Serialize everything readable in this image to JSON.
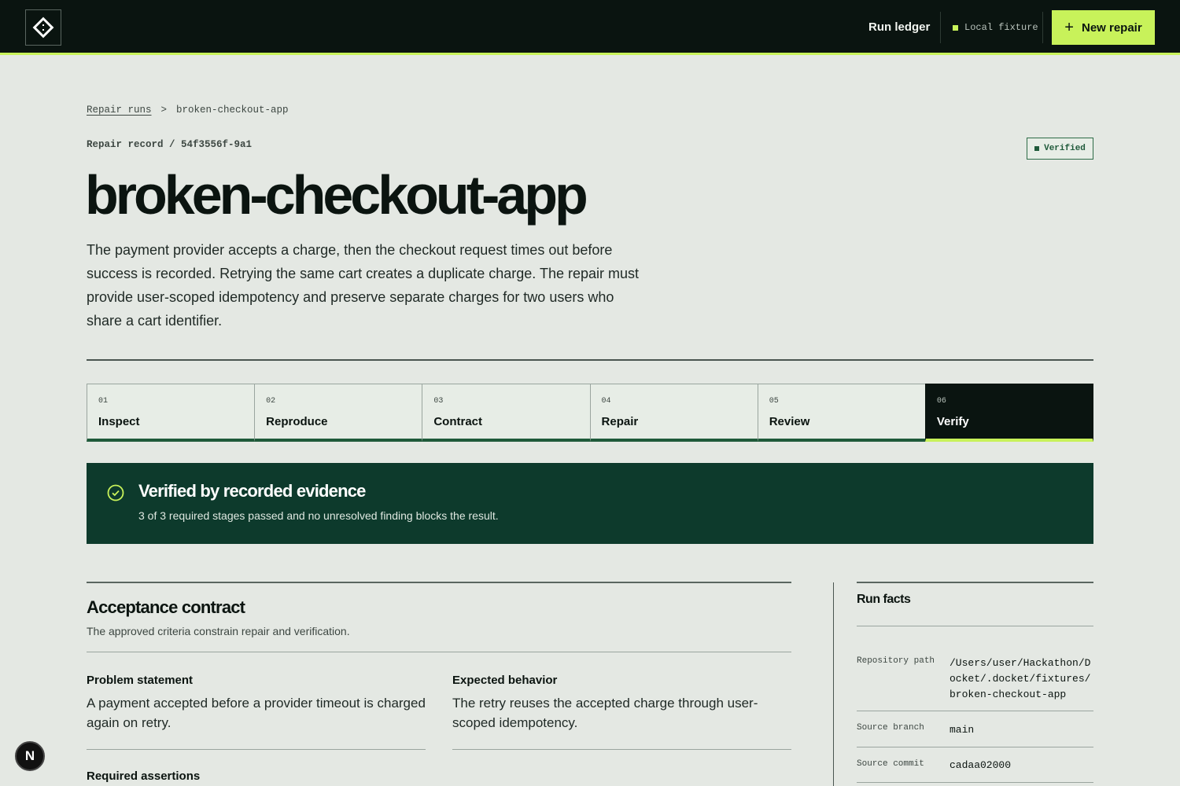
{
  "topbar": {
    "logo_icon": "diamond-code-icon",
    "nav_link": "Run ledger",
    "fixture_label": "Local fixture",
    "new_repair_label": "New repair",
    "accent_color": "#c8f25a"
  },
  "breadcrumb": {
    "parent": "Repair runs",
    "separator": ">",
    "current": "broken-checkout-app"
  },
  "record": {
    "label": "Repair record / 54f3556f-9a1",
    "status_badge": "Verified",
    "title": "broken-checkout-app",
    "description": "The payment provider accepts a charge, then the checkout request times out before success is recorded. Retrying the same cart creates a duplicate charge. The repair must provide user-scoped idempotency and preserve separate charges for two users who share a cart identifier."
  },
  "steps": [
    {
      "num": "01",
      "label": "Inspect"
    },
    {
      "num": "02",
      "label": "Reproduce"
    },
    {
      "num": "03",
      "label": "Contract"
    },
    {
      "num": "04",
      "label": "Repair"
    },
    {
      "num": "05",
      "label": "Review"
    },
    {
      "num": "06",
      "label": "Verify"
    }
  ],
  "verified_panel": {
    "title": "Verified by recorded evidence",
    "subtitle": "3 of 3 required stages passed and no unresolved finding blocks the result.",
    "color": "#0d3a2c"
  },
  "contract": {
    "title": "Acceptance contract",
    "subtitle": "The approved criteria constrain repair and verification.",
    "problem_heading": "Problem statement",
    "problem_body": "A payment accepted before a provider timeout is charged again on retry.",
    "expected_heading": "Expected behavior",
    "expected_body": "The retry reuses the accepted charge through user-scoped idempotency.",
    "required_heading": "Required assertions"
  },
  "run_facts": {
    "title": "Run facts",
    "items": [
      {
        "key": "Repository path",
        "value": "/Users/user/Hackathon/Docket/.docket/fixtures/broken-checkout-app"
      },
      {
        "key": "Source branch",
        "value": "main"
      },
      {
        "key": "Source commit",
        "value": "cadaa02000"
      }
    ]
  },
  "floating_button": {
    "label": "N"
  }
}
